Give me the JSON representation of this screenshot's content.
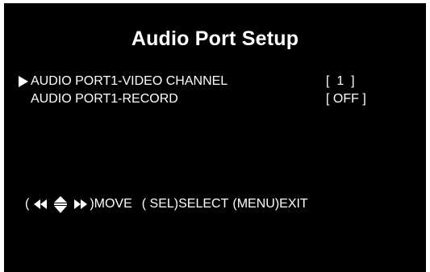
{
  "screen": {
    "title": "Audio Port Setup"
  },
  "menu": {
    "items": [
      {
        "label": "AUDIO PORT1-VIDEO CHANNEL",
        "value": "[  1  ]",
        "selected": true
      },
      {
        "label": "AUDIO PORT1-RECORD",
        "value": "[ OFF ]",
        "selected": false
      }
    ]
  },
  "hint": {
    "open_paren": "(",
    "move_label": ")MOVE",
    "select_label": "( SEL)SELECT",
    "exit_label": "(MENU)EXIT",
    "icon": "direction-arrows-icon"
  },
  "colors": {
    "background": "#000000",
    "foreground": "#ffffff"
  }
}
